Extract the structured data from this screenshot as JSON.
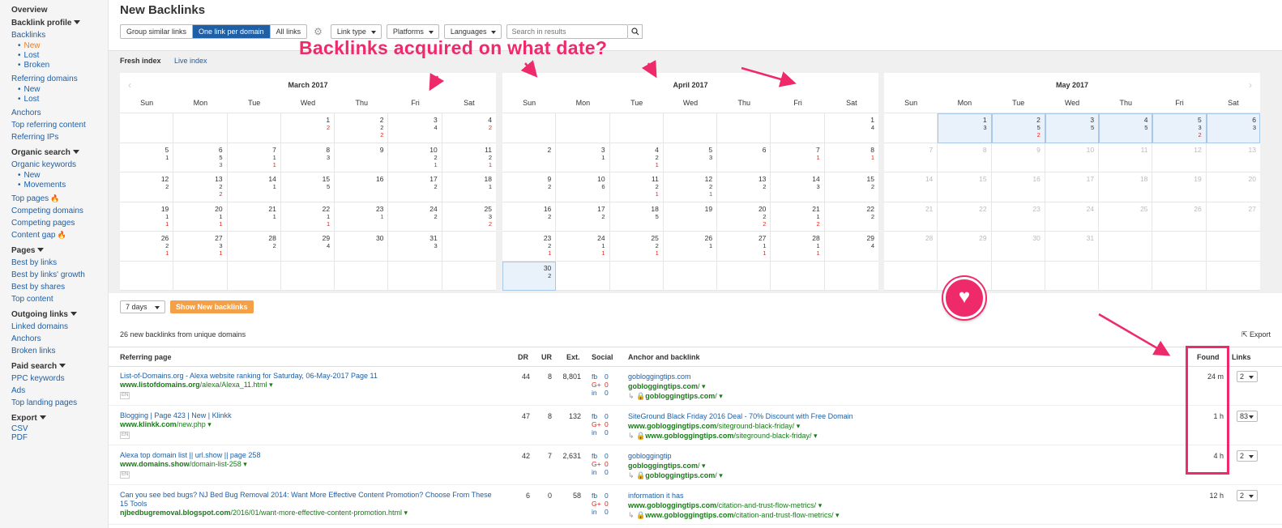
{
  "sidebar": {
    "overview": "Overview",
    "backlink_profile": "Backlink profile",
    "backlinks": "Backlinks",
    "bl_new": "New",
    "bl_lost": "Lost",
    "bl_broken": "Broken",
    "referring_domains": "Referring domains",
    "rd_new": "New",
    "rd_lost": "Lost",
    "anchors": "Anchors",
    "top_referring_content": "Top referring content",
    "referring_ips": "Referring IPs",
    "organic_search": "Organic search",
    "organic_keywords": "Organic keywords",
    "ok_new": "New",
    "ok_movements": "Movements",
    "top_pages": "Top pages",
    "competing_domains": "Competing domains",
    "competing_pages": "Competing pages",
    "content_gap": "Content gap",
    "pages": "Pages",
    "best_by_links": "Best by links",
    "best_by_links_growth": "Best by links' growth",
    "best_by_shares": "Best by shares",
    "top_content": "Top content",
    "outgoing_links": "Outgoing links",
    "linked_domains": "Linked domains",
    "out_anchors": "Anchors",
    "broken_links": "Broken links",
    "paid_search": "Paid search",
    "ppc_keywords": "PPC keywords",
    "ads": "Ads",
    "top_landing_pages": "Top landing pages",
    "export": "Export",
    "csv": "CSV",
    "pdf": "PDF"
  },
  "header": {
    "title": "New Backlinks",
    "group_similar": "Group similar links",
    "one_per_domain": "One link per domain",
    "all_links": "All links",
    "link_type": "Link type",
    "platforms": "Platforms",
    "languages": "Languages",
    "search_placeholder": "Search in results"
  },
  "index": {
    "fresh": "Fresh index",
    "live": "Live index"
  },
  "weekdays": [
    "Sun",
    "Mon",
    "Tue",
    "Wed",
    "Thu",
    "Fri",
    "Sat"
  ],
  "calendars": [
    {
      "title": "March 2017",
      "cells": [
        [
          "",
          "",
          ""
        ],
        [
          "",
          "",
          ""
        ],
        [
          "",
          "",
          ""
        ],
        [
          "1",
          "",
          "2"
        ],
        [
          "2",
          "2",
          "2"
        ],
        [
          "3",
          "4",
          ""
        ],
        [
          "4",
          "",
          "2"
        ],
        [
          "5",
          "1",
          ""
        ],
        [
          "6",
          "5",
          "3"
        ],
        [
          "7",
          "1",
          "1"
        ],
        [
          "8",
          "3",
          ""
        ],
        [
          "9",
          "",
          ""
        ],
        [
          "10",
          "2",
          "1"
        ],
        [
          "11",
          "2",
          "1"
        ],
        [
          "12",
          "2",
          ""
        ],
        [
          "13",
          "2",
          "2"
        ],
        [
          "14",
          "1",
          ""
        ],
        [
          "15",
          "5",
          ""
        ],
        [
          "16",
          "",
          ""
        ],
        [
          "17",
          "2",
          ""
        ],
        [
          "18",
          "1",
          ""
        ],
        [
          "19",
          "1",
          "1"
        ],
        [
          "20",
          "1",
          "1"
        ],
        [
          "21",
          "1",
          ""
        ],
        [
          "22",
          "1",
          "1"
        ],
        [
          "23",
          "",
          "1"
        ],
        [
          "24",
          "2",
          ""
        ],
        [
          "25",
          "3",
          "2"
        ],
        [
          "26",
          "2",
          "1"
        ],
        [
          "27",
          "3",
          "1"
        ],
        [
          "28",
          "2",
          ""
        ],
        [
          "29",
          "4",
          ""
        ],
        [
          "30",
          "",
          ""
        ],
        [
          "31",
          "3",
          ""
        ],
        [
          "",
          "",
          ""
        ],
        [
          "",
          "",
          ""
        ],
        [
          "",
          "",
          ""
        ],
        [
          "",
          "",
          ""
        ],
        [
          "",
          "",
          ""
        ],
        [
          "",
          "",
          ""
        ],
        [
          "",
          "",
          ""
        ],
        [
          "",
          "",
          ""
        ]
      ]
    },
    {
      "title": "April 2017",
      "cells": [
        [
          "",
          "",
          ""
        ],
        [
          "",
          "",
          ""
        ],
        [
          "",
          "",
          ""
        ],
        [
          "",
          "",
          ""
        ],
        [
          "",
          "",
          ""
        ],
        [
          "",
          "",
          ""
        ],
        [
          "1",
          "4",
          ""
        ],
        [
          "2",
          "",
          ""
        ],
        [
          "3",
          "1",
          ""
        ],
        [
          "4",
          "2",
          "1"
        ],
        [
          "5",
          "3",
          ""
        ],
        [
          "6",
          "",
          ""
        ],
        [
          "7",
          "",
          "1"
        ],
        [
          "8",
          "",
          "1"
        ],
        [
          "9",
          "2",
          ""
        ],
        [
          "10",
          "6",
          ""
        ],
        [
          "11",
          "2",
          "1"
        ],
        [
          "12",
          "2",
          "1"
        ],
        [
          "13",
          "2",
          ""
        ],
        [
          "14",
          "3",
          ""
        ],
        [
          "15",
          "2",
          ""
        ],
        [
          "16",
          "2",
          ""
        ],
        [
          "17",
          "2",
          ""
        ],
        [
          "18",
          "5",
          ""
        ],
        [
          "19",
          "",
          ""
        ],
        [
          "20",
          "2",
          "2"
        ],
        [
          "21",
          "1",
          "2"
        ],
        [
          "22",
          "2",
          ""
        ],
        [
          "23",
          "2",
          "1"
        ],
        [
          "24",
          "1",
          "1"
        ],
        [
          "25",
          "2",
          "1"
        ],
        [
          "26",
          "1",
          ""
        ],
        [
          "27",
          "1",
          "1"
        ],
        [
          "28",
          "1",
          "1"
        ],
        [
          "29",
          "4",
          ""
        ],
        [
          "30",
          "2",
          ""
        ],
        [
          "",
          "",
          ""
        ],
        [
          "",
          "",
          ""
        ],
        [
          "",
          "",
          ""
        ],
        [
          "",
          "",
          ""
        ],
        [
          "",
          "",
          ""
        ],
        [
          "",
          "",
          ""
        ]
      ]
    },
    {
      "title": "May 2017",
      "cells": [
        [
          "",
          "",
          ""
        ],
        [
          "1",
          "3",
          ""
        ],
        [
          "2",
          "5",
          "2"
        ],
        [
          "3",
          "5",
          ""
        ],
        [
          "4",
          "5",
          ""
        ],
        [
          "5",
          "3",
          "2"
        ],
        [
          "6",
          "3",
          ""
        ],
        [
          "7",
          "",
          ""
        ],
        [
          "8",
          "",
          ""
        ],
        [
          "9",
          "",
          ""
        ],
        [
          "10",
          "",
          ""
        ],
        [
          "11",
          "",
          ""
        ],
        [
          "12",
          "",
          ""
        ],
        [
          "13",
          "",
          ""
        ],
        [
          "14",
          "",
          ""
        ],
        [
          "15",
          "",
          ""
        ],
        [
          "16",
          "",
          ""
        ],
        [
          "17",
          "",
          ""
        ],
        [
          "18",
          "",
          ""
        ],
        [
          "19",
          "",
          ""
        ],
        [
          "20",
          "",
          ""
        ],
        [
          "21",
          "",
          ""
        ],
        [
          "22",
          "",
          ""
        ],
        [
          "23",
          "",
          ""
        ],
        [
          "24",
          "",
          ""
        ],
        [
          "25",
          "",
          ""
        ],
        [
          "26",
          "",
          ""
        ],
        [
          "27",
          "",
          ""
        ],
        [
          "28",
          "",
          ""
        ],
        [
          "29",
          "",
          ""
        ],
        [
          "30",
          "",
          ""
        ],
        [
          "31",
          "",
          ""
        ],
        [
          "",
          "",
          ""
        ],
        [
          "",
          "",
          ""
        ],
        [
          "",
          "",
          ""
        ],
        [
          "",
          "",
          ""
        ],
        [
          "",
          "",
          ""
        ],
        [
          "",
          "",
          ""
        ],
        [
          "",
          "",
          ""
        ],
        [
          "",
          "",
          ""
        ],
        [
          "",
          "",
          ""
        ],
        [
          "",
          "",
          ""
        ]
      ]
    }
  ],
  "controls": {
    "days": "7 days",
    "show": "Show New backlinks"
  },
  "summary": "26 new backlinks from unique domains",
  "export_label": "Export",
  "table": {
    "headers": {
      "referring_page": "Referring page",
      "dr": "DR",
      "ur": "UR",
      "ext": "Ext.",
      "social": "Social",
      "anchor": "Anchor and backlink",
      "found": "Found",
      "links": "Links"
    },
    "rows": [
      {
        "title": "List-of-Domains.org - Alexa website ranking for Saturday, 06-May-2017 Page 11",
        "domain": "www.listofdomains.org",
        "path": "/alexa/Alexa_11.html",
        "lang": "EN",
        "dr": "44",
        "ur": "8",
        "ext": "8,801",
        "fb": "0",
        "gp": "0",
        "in": "0",
        "anchor": "gobloggingtips.com",
        "bl1_domain": "gobloggingtips.com",
        "bl1_path": "/",
        "bl2_domain": "gobloggingtips.com",
        "bl2_path": "/",
        "found": "24 m",
        "links": "2"
      },
      {
        "title": "Blogging | Page 423 | New | Klinkk",
        "domain": "www.klinkk.com",
        "path": "/new.php",
        "lang": "EN",
        "dr": "47",
        "ur": "8",
        "ext": "132",
        "fb": "0",
        "gp": "0",
        "in": "0",
        "anchor": "SiteGround Black Friday 2016 Deal - 70% Discount with Free Domain",
        "bl1_domain": "www.gobloggingtips.com",
        "bl1_path": "/siteground-black-friday/",
        "bl2_domain": "www.gobloggingtips.com",
        "bl2_path": "/siteground-black-friday/",
        "found": "1 h",
        "links": "83"
      },
      {
        "title": "Alexa top domain list || url.show || page 258",
        "domain": "www.domains.show",
        "path": "/domain-list-258",
        "lang": "EN",
        "dr": "42",
        "ur": "7",
        "ext": "2,631",
        "fb": "0",
        "gp": "0",
        "in": "0",
        "anchor": "gobloggingtip",
        "bl1_domain": "gobloggingtips.com",
        "bl1_path": "/",
        "bl2_domain": "gobloggingtips.com",
        "bl2_path": "/",
        "found": "4 h",
        "links": "2"
      },
      {
        "title": "Can you see bed bugs? NJ Bed Bug Removal 2014: Want More Effective Content Promotion? Choose From These 15 Tools",
        "domain": "njbedbugremoval.blogspot.com",
        "path": "/2016/01/want-more-effective-content-promotion.html",
        "lang": "",
        "dr": "6",
        "ur": "0",
        "ext": "58",
        "fb": "0",
        "gp": "0",
        "in": "0",
        "anchor": "information it has",
        "bl1_domain": "www.gobloggingtips.com",
        "bl1_path": "/citation-and-trust-flow-metrics/",
        "bl2_domain": "www.gobloggingtips.com",
        "bl2_path": "/citation-and-trust-flow-metrics/",
        "found": "12 h",
        "links": "2"
      }
    ]
  },
  "annotation": {
    "question": "Backlinks acquired on what date?",
    "accent": "#ef2a6b"
  },
  "colors": {
    "brand_blue": "#1f5fa5",
    "link_green": "#1a7a1a",
    "orange": "#f4a049",
    "red": "#d9281f"
  }
}
